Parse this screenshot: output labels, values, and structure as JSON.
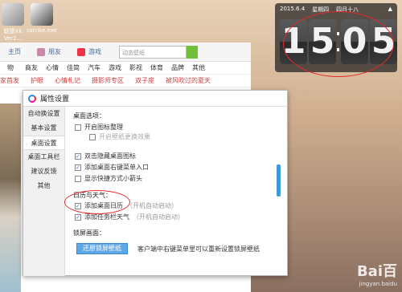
{
  "desktop": {
    "icons": [
      {
        "label": "联盟Xk\nVer2...",
        "icon": "game-app-icon"
      },
      {
        "label": "cstrike.exe",
        "icon": "cstrike-icon"
      }
    ]
  },
  "clock": {
    "date": "2015.6.4",
    "weekday": "星期四",
    "lunar": "四月十八",
    "arrow": "▲",
    "digits": [
      "1",
      "5",
      "0",
      "5"
    ]
  },
  "browser": {
    "tabs": [
      "主页",
      "朋友",
      "游戏"
    ],
    "search_placeholder": "动态壁纸",
    "nav1": [
      "物",
      "商友",
      "心情",
      "佳简",
      "汽车",
      "游戏",
      "影视",
      "体育",
      "品牌",
      "其他"
    ],
    "nav2": [
      "家首发",
      "护眼",
      "心情札记",
      "摄影师专区",
      "双子座",
      "被风吹过的夏天"
    ]
  },
  "dialog": {
    "title": "属性设置",
    "sidebar": [
      "自动换设置",
      "基本设置",
      "桌面设置",
      "桌面工具栏",
      "建议反馈",
      "其他"
    ],
    "section_desktop": "桌面选项：",
    "opt_icon_arrange": "开启图标整理",
    "opt_icon_effect": "开启壁纸更换效果",
    "opt_double_click": "双击隐藏桌面图标",
    "opt_right_click": "添加桌面右键菜单入口",
    "opt_small_arrow": "显示快捷方式小箭头",
    "section_calendar": "日历与天气：",
    "opt_calendar": "添加桌面日历",
    "opt_calendar_hint": "（开机自动启动）",
    "opt_weather": "添加任务栏天气",
    "opt_weather_hint": "（开机自动启动）",
    "section_lock": "锁屏画面：",
    "restore_button": "还原锁屏壁纸",
    "restore_note": "客户端中右键菜单里可以重新设置锁屏壁纸"
  },
  "watermark": {
    "brand": "Bai百",
    "sub": "jingyan.baidu"
  }
}
